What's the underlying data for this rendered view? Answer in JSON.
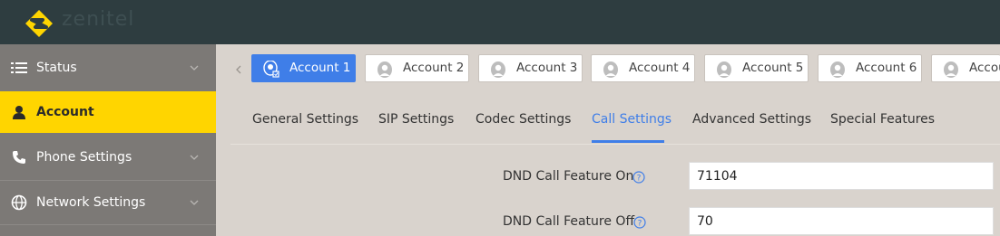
{
  "brand": {
    "logo_text": "zenitel"
  },
  "sidebar": {
    "items": [
      {
        "label": "Status"
      },
      {
        "label": "Account"
      },
      {
        "label": "Phone Settings"
      },
      {
        "label": "Network Settings"
      }
    ]
  },
  "accounts": [
    {
      "label": "Account 1"
    },
    {
      "label": "Account 2"
    },
    {
      "label": "Account 3"
    },
    {
      "label": "Account 4"
    },
    {
      "label": "Account 5"
    },
    {
      "label": "Account 6"
    },
    {
      "label": "Accou"
    }
  ],
  "tabs": [
    {
      "label": "General Settings"
    },
    {
      "label": "SIP Settings"
    },
    {
      "label": "Codec Settings"
    },
    {
      "label": "Call Settings"
    },
    {
      "label": "Advanced Settings"
    },
    {
      "label": "Special Features"
    }
  ],
  "fields": [
    {
      "label": "DND Call Feature On",
      "value": "71104"
    },
    {
      "label": "DND Call Feature Off",
      "value": "70"
    }
  ],
  "colors": {
    "topbar": "#2e3d40",
    "sidebar": "#7c7976",
    "active_nav": "#ffd500",
    "accent": "#3f7ee8",
    "content_bg": "#d9d3cd"
  }
}
